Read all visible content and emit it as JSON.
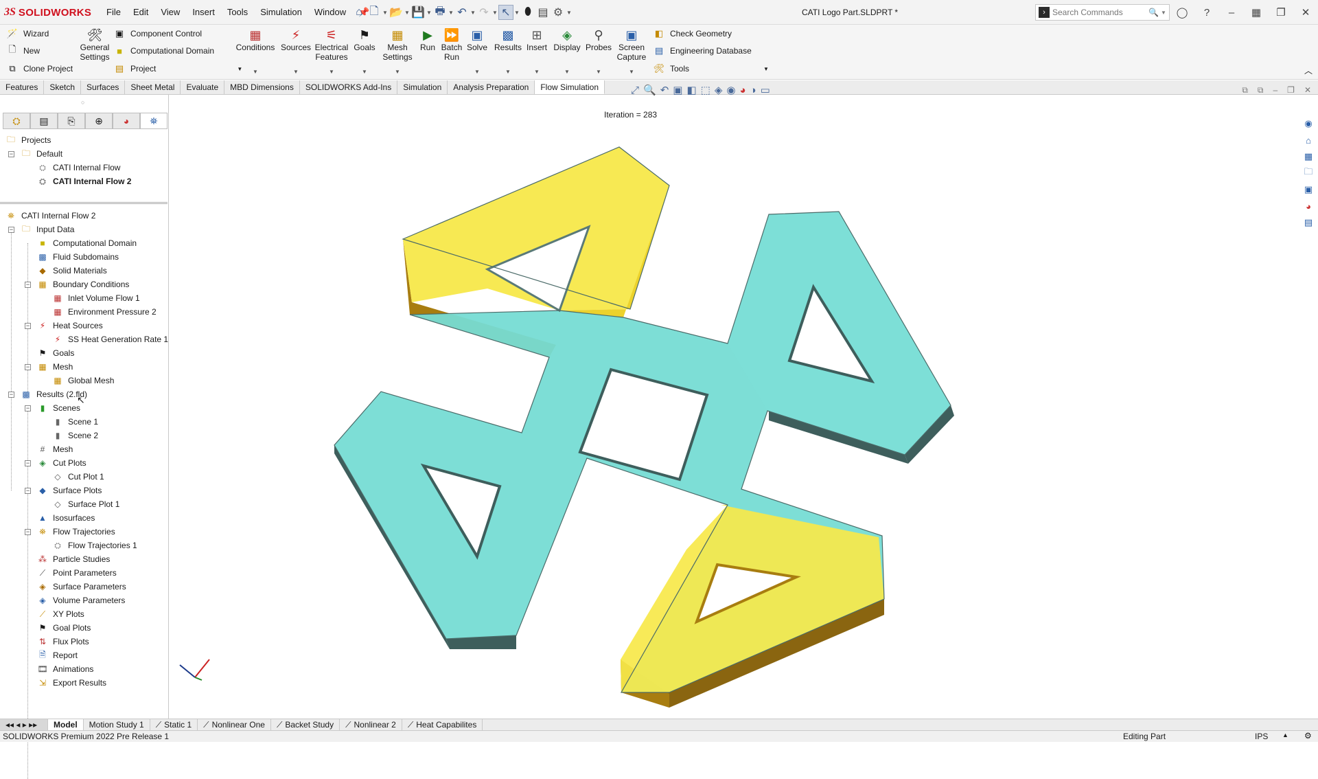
{
  "app": {
    "brand": "SOLIDWORKS",
    "document_title": "CATI Logo Part.SLDPRT *"
  },
  "menu": [
    "File",
    "Edit",
    "View",
    "Insert",
    "Tools",
    "Simulation",
    "Window"
  ],
  "search": {
    "placeholder": "Search Commands"
  },
  "command_manager": {
    "left_items": [
      "Wizard",
      "New",
      "Clone Project"
    ],
    "general_settings": "General Settings",
    "mid_items": [
      "Component Control",
      "Computational Domain",
      "Project"
    ],
    "big_buttons": [
      "Conditions",
      "Sources",
      "Electrical Features",
      "Goals",
      "Mesh Settings",
      "Run",
      "Batch Run",
      "Solve",
      "Results",
      "Insert",
      "Display",
      "Probes",
      "Screen Capture"
    ],
    "right_items": [
      "Check Geometry",
      "Engineering Database",
      "Tools"
    ]
  },
  "tabs": [
    "Features",
    "Sketch",
    "Surfaces",
    "Sheet Metal",
    "Evaluate",
    "MBD Dimensions",
    "SOLIDWORKS Add-Ins",
    "Simulation",
    "Analysis Preparation",
    "Flow Simulation"
  ],
  "active_tab": "Flow Simulation",
  "projects_tree": {
    "root": "Projects",
    "default": "Default",
    "items": [
      "CATI Internal Flow",
      "CATI Internal Flow 2"
    ]
  },
  "flow_tree": {
    "root": "CATI Internal Flow 2",
    "input_data": "Input Data",
    "computational_domain": "Computational Domain",
    "fluid_subdomains": "Fluid Subdomains",
    "solid_materials": "Solid Materials",
    "boundary_conditions": "Boundary Conditions",
    "inlet": "Inlet Volume Flow 1",
    "env_pressure": "Environment Pressure 2",
    "heat_sources": "Heat Sources",
    "ss_heat": "SS Heat Generation Rate 1",
    "goals": "Goals",
    "mesh": "Mesh",
    "global_mesh": "Global Mesh",
    "results": "Results (2.fld)",
    "scenes": "Scenes",
    "scene1": "Scene 1",
    "scene2": "Scene 2",
    "results_mesh": "Mesh",
    "cut_plots": "Cut Plots",
    "cut_plot1": "Cut Plot 1",
    "surface_plots": "Surface Plots",
    "surface_plot1": "Surface Plot 1",
    "isosurfaces": "Isosurfaces",
    "flow_trajectories": "Flow Trajectories",
    "flow_trajectories1": "Flow Trajectories 1",
    "particle_studies": "Particle Studies",
    "point_parameters": "Point Parameters",
    "surface_parameters": "Surface Parameters",
    "volume_parameters": "Volume Parameters",
    "xy_plots": "XY Plots",
    "goal_plots": "Goal Plots",
    "flux_plots": "Flux Plots",
    "report": "Report",
    "animations": "Animations",
    "export_results": "Export Results"
  },
  "viewport": {
    "iteration": "Iteration = 283"
  },
  "bottom_tabs": [
    "Model",
    "Motion Study 1",
    "Static 1",
    "Nonlinear One",
    "Backet Study",
    "Nonlinear 2",
    "Heat Capabilites"
  ],
  "status": {
    "left": "SOLIDWORKS Premium 2022 Pre Release 1",
    "mode": "Editing Part",
    "units": "IPS"
  },
  "colors": {
    "brand": "#d0101e",
    "cyan_part": "#76dcd4",
    "yellow_part": "#f7e84a"
  }
}
